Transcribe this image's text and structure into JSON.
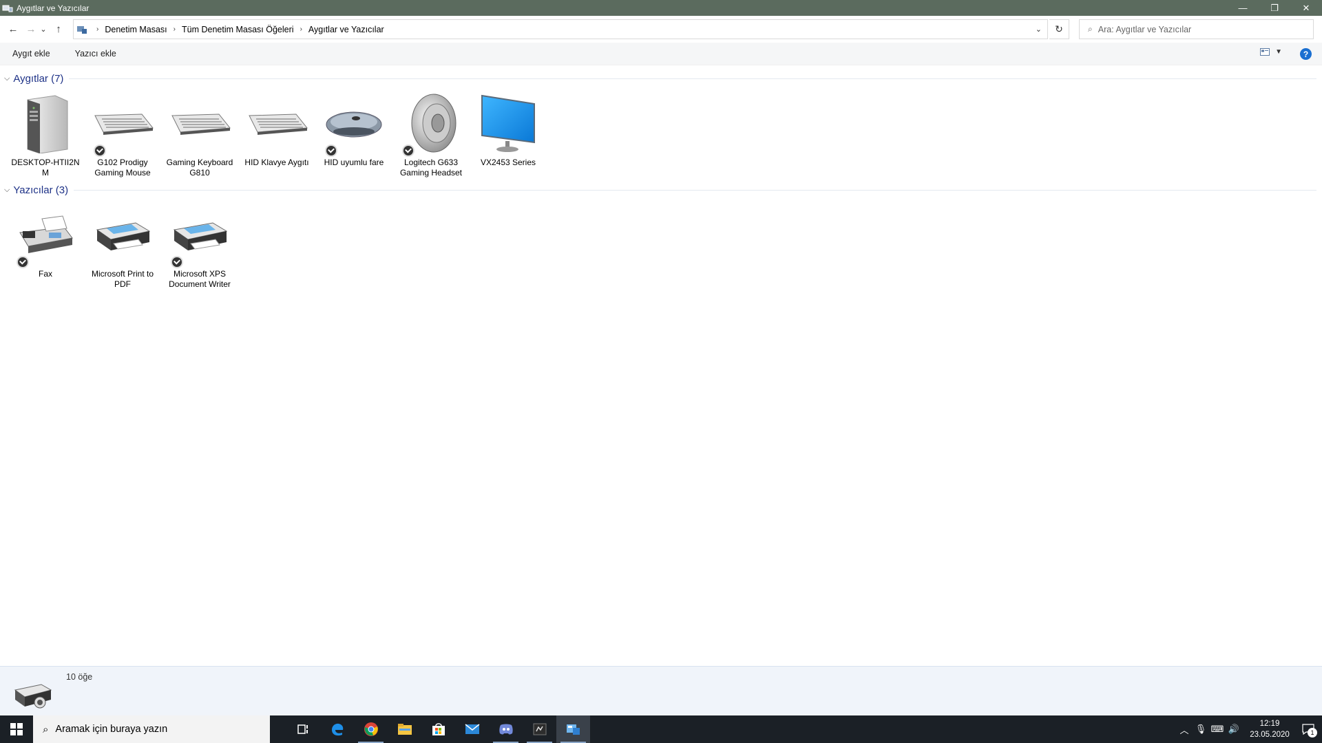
{
  "window": {
    "title": "Aygıtlar ve Yazıcılar",
    "minimize": "—",
    "restore": "❐",
    "close": "✕"
  },
  "nav": {
    "back": "←",
    "forward": "→",
    "recent": "⌄",
    "up": "↑"
  },
  "address": {
    "crumbs": [
      "Denetim Masası",
      "Tüm Denetim Masası Öğeleri",
      "Aygıtlar ve Yazıcılar"
    ],
    "separator": "›",
    "dropdown": "⌄",
    "refresh": "↻"
  },
  "search": {
    "placeholder": "Ara: Aygıtlar ve Yazıcılar"
  },
  "toolbar": {
    "add_device": "Aygıt ekle",
    "add_printer": "Yazıcı ekle",
    "help": "?"
  },
  "groups": {
    "devices": {
      "header": "Aygıtlar (7)",
      "items": [
        {
          "label": "DESKTOP-HTII2N M",
          "icon": "computer-tower-icon",
          "badge": false
        },
        {
          "label": "G102 Prodigy Gaming Mouse",
          "icon": "keyboard-icon",
          "badge": true
        },
        {
          "label": "Gaming Keyboard G810",
          "icon": "keyboard-icon",
          "badge": false
        },
        {
          "label": "HID Klavye Aygıtı",
          "icon": "keyboard-icon",
          "badge": false
        },
        {
          "label": "HID uyumlu fare",
          "icon": "mouse-icon",
          "badge": true
        },
        {
          "label": "Logitech G633 Gaming Headset",
          "icon": "speaker-icon",
          "badge": true
        },
        {
          "label": "VX2453 Series",
          "icon": "monitor-icon",
          "badge": false
        }
      ]
    },
    "printers": {
      "header": "Yazıcılar (3)",
      "items": [
        {
          "label": "Fax",
          "icon": "fax-icon",
          "badge": true
        },
        {
          "label": "Microsoft Print to PDF",
          "icon": "printer-icon",
          "badge": false
        },
        {
          "label": "Microsoft XPS Document Writer",
          "icon": "printer-icon",
          "badge": true
        }
      ]
    }
  },
  "details": {
    "count": "10 öğe"
  },
  "taskbar": {
    "search_placeholder": "Aramak için buraya yazın",
    "time": "12:19",
    "date": "23.05.2020",
    "notification_count": "1"
  }
}
